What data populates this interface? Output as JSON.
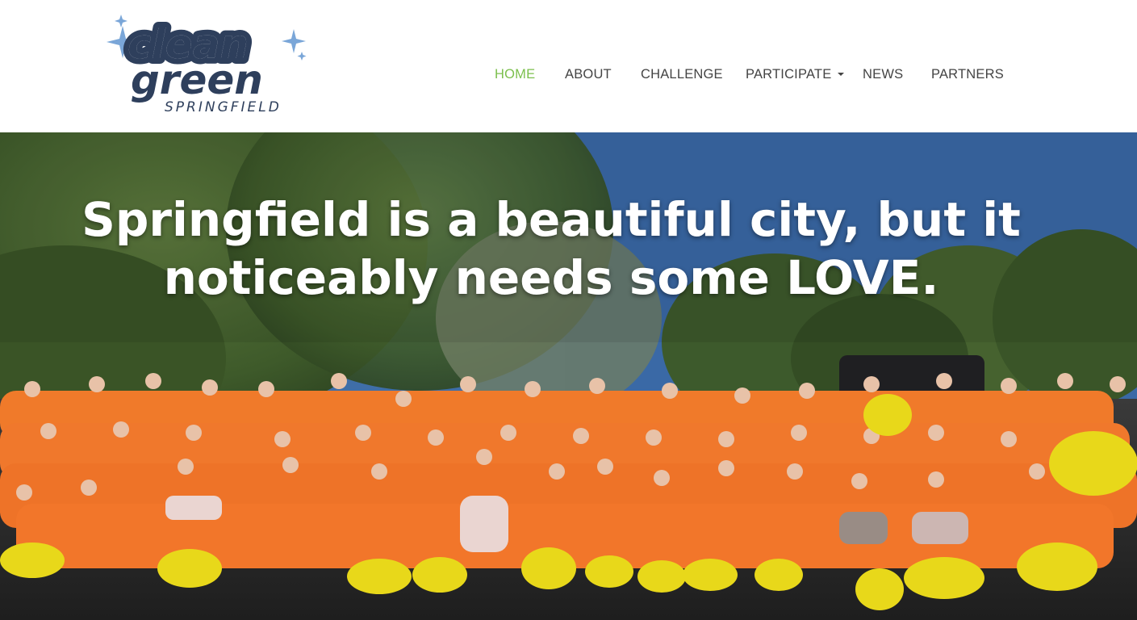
{
  "site": {
    "logo": {
      "line1": "clean",
      "line2": "green",
      "line3": "SPRINGFIELD",
      "colors": {
        "text": "#2e3f5c",
        "sparkle": "#7aa6d8"
      }
    }
  },
  "nav": {
    "items": [
      {
        "label": "HOME",
        "active": true
      },
      {
        "label": "ABOUT"
      },
      {
        "label": "CHALLENGE"
      },
      {
        "label": "PARTICIPATE",
        "dropdown": true
      },
      {
        "label": "NEWS"
      },
      {
        "label": "PARTNERS"
      }
    ],
    "active_color": "#7bbf4c",
    "text_color": "#444444"
  },
  "hero": {
    "headline_line1": "Springfield is a beautiful city, but it",
    "headline_line2": "noticeably needs some LOVE.",
    "image": "group photo of volunteers in orange safety vests holding yellow trash bags under trees and blue sky"
  }
}
